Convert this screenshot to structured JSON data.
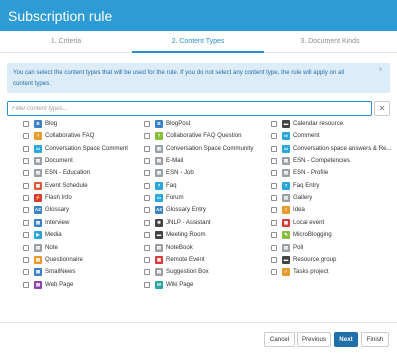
{
  "dialog": {
    "title": "Subscription rule"
  },
  "tabs": [
    {
      "label": "1. Criteria"
    },
    {
      "label": "2. Content Types"
    },
    {
      "label": "3. Document Kinds"
    }
  ],
  "info": {
    "text": "You can select the content types that will be used for the rule. If you do not select any content type, the rule will apply on all content types.",
    "close_glyph": "x"
  },
  "filter": {
    "placeholder": "Filter content types...",
    "value": "",
    "clear_glyph": "✕"
  },
  "content_types": [
    {
      "label": "Blog",
      "icon": "blog-icon",
      "glyph": "B",
      "color": "#3b82c4"
    },
    {
      "label": "BlogPost",
      "icon": "blogpost-icon",
      "glyph": "B",
      "color": "#3b82c4"
    },
    {
      "label": "Calendar resource",
      "icon": "calendar-resource-icon",
      "glyph": "▬",
      "color": "#444444"
    },
    {
      "label": "Collaborative FAQ",
      "icon": "collaborative-faq-icon",
      "glyph": "?",
      "color": "#e89a2c"
    },
    {
      "label": "Collaborative FAQ Question",
      "icon": "collaborative-faq-question-icon",
      "glyph": "?",
      "color": "#8bbd3c"
    },
    {
      "label": "Comment",
      "icon": "comment-icon",
      "glyph": "▭",
      "color": "#2aa6d8"
    },
    {
      "label": "Conversation Space Comment",
      "icon": "conversation-comment-icon",
      "glyph": "▭",
      "color": "#2aa6d8"
    },
    {
      "label": "Conversation Space Community",
      "icon": "conversation-community-icon",
      "glyph": "▤",
      "color": "#9aa0a6"
    },
    {
      "label": "Conversation space answers & Re...",
      "icon": "conversation-answers-icon",
      "glyph": "▭",
      "color": "#2aa6d8"
    },
    {
      "label": "Document",
      "icon": "document-icon",
      "glyph": "▤",
      "color": "#9aa0a6"
    },
    {
      "label": "E-Mail",
      "icon": "email-icon",
      "glyph": "▤",
      "color": "#9aa0a6"
    },
    {
      "label": "ESN - Competencies",
      "icon": "esn-competencies-icon",
      "glyph": "▤",
      "color": "#9aa0a6"
    },
    {
      "label": "ESN - Education",
      "icon": "esn-education-icon",
      "glyph": "▤",
      "color": "#9aa0a6"
    },
    {
      "label": "ESN - Job",
      "icon": "esn-job-icon",
      "glyph": "▤",
      "color": "#9aa0a6"
    },
    {
      "label": "ESN - Profile",
      "icon": "esn-profile-icon",
      "glyph": "▤",
      "color": "#9aa0a6"
    },
    {
      "label": "Event Schedule",
      "icon": "event-schedule-icon",
      "glyph": "▦",
      "color": "#e05a3a"
    },
    {
      "label": "Faq",
      "icon": "faq-icon",
      "glyph": "?",
      "color": "#2aa6d8"
    },
    {
      "label": "Faq Entry",
      "icon": "faq-entry-icon",
      "glyph": "?",
      "color": "#2aa6d8"
    },
    {
      "label": "Flash Info",
      "icon": "flash-info-icon",
      "glyph": "⚡",
      "color": "#d83a3a"
    },
    {
      "label": "Forum",
      "icon": "forum-icon",
      "glyph": "▭",
      "color": "#2aa6d8"
    },
    {
      "label": "Gallery",
      "icon": "gallery-icon",
      "glyph": "▨",
      "color": "#9aa0a6"
    },
    {
      "label": "Glossary",
      "icon": "glossary-icon",
      "glyph": "AZ",
      "color": "#3b82c4"
    },
    {
      "label": "Glossary Entry",
      "icon": "glossary-entry-icon",
      "glyph": "AZ",
      "color": "#3b82c4"
    },
    {
      "label": "Idea",
      "icon": "idea-icon",
      "glyph": "!",
      "color": "#e89a2c"
    },
    {
      "label": "Interview",
      "icon": "interview-icon",
      "glyph": "▤",
      "color": "#3b82c4"
    },
    {
      "label": "JNLP - Assistant",
      "icon": "jnlp-assistant-icon",
      "glyph": "✱",
      "color": "#444444"
    },
    {
      "label": "Local event",
      "icon": "local-event-icon",
      "glyph": "▦",
      "color": "#d83a3a"
    },
    {
      "label": "Media",
      "icon": "media-icon",
      "glyph": "▶",
      "color": "#2aa6d8"
    },
    {
      "label": "Meeting Room",
      "icon": "meeting-room-icon",
      "glyph": "▬",
      "color": "#444444"
    },
    {
      "label": "MicroBlogging",
      "icon": "microblogging-icon",
      "glyph": "✎",
      "color": "#8bbd3c"
    },
    {
      "label": "Note",
      "icon": "note-icon",
      "glyph": "▤",
      "color": "#9aa0a6"
    },
    {
      "label": "NoteBook",
      "icon": "notebook-icon",
      "glyph": "▤",
      "color": "#9aa0a6"
    },
    {
      "label": "Poll",
      "icon": "poll-icon",
      "glyph": "▥",
      "color": "#9aa0a6"
    },
    {
      "label": "Questionnaire",
      "icon": "questionnaire-icon",
      "glyph": "▤",
      "color": "#e89a2c"
    },
    {
      "label": "Remote Event",
      "icon": "remote-event-icon",
      "glyph": "▦",
      "color": "#d83a3a"
    },
    {
      "label": "Resource group",
      "icon": "resource-group-icon",
      "glyph": "▬",
      "color": "#444444"
    },
    {
      "label": "SmallNews",
      "icon": "smallnews-icon",
      "glyph": "▤",
      "color": "#3b82c4"
    },
    {
      "label": "Suggestion Box",
      "icon": "suggestion-box-icon",
      "glyph": "▤",
      "color": "#9aa0a6"
    },
    {
      "label": "Tasks project",
      "icon": "tasks-project-icon",
      "glyph": "✓",
      "color": "#e89a2c"
    },
    {
      "label": "Web Page",
      "icon": "web-page-icon",
      "glyph": "▤",
      "color": "#8e44ad"
    },
    {
      "label": "Wiki Page",
      "icon": "wiki-page-icon",
      "glyph": "W",
      "color": "#2aa6a0"
    }
  ],
  "footer": {
    "cancel_label": "Cancel",
    "previous_label": "Previous",
    "next_label": "Next",
    "finish_label": "Finish"
  },
  "colors": {
    "header": "#2d9bd5",
    "accent": "#2d8fc9",
    "primary_button": "#1f6fa8",
    "info_bg": "#dcecf8"
  }
}
